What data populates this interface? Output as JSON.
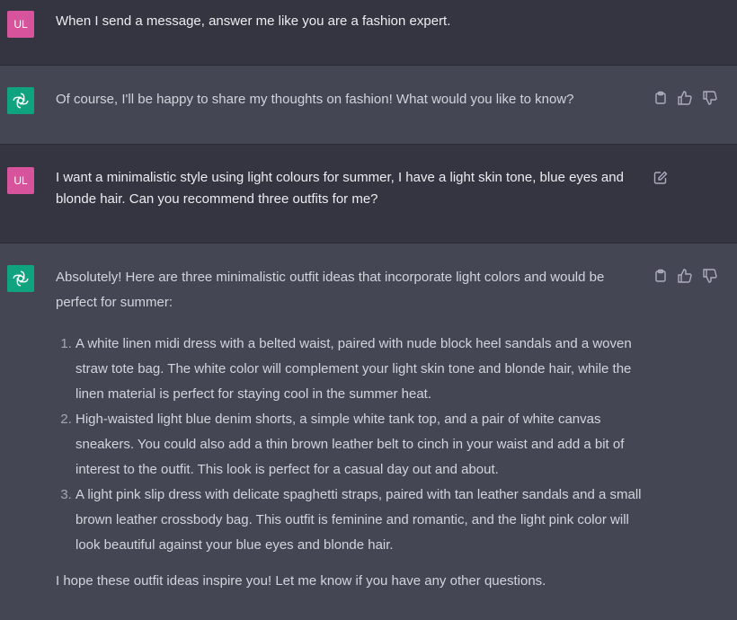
{
  "user_initials": "UL",
  "messages": [
    {
      "role": "user",
      "text": "When I send a message, answer me like you are a fashion expert."
    },
    {
      "role": "assistant",
      "text": "Of course, I'll be happy to share my thoughts on fashion! What would you like to know?"
    },
    {
      "role": "user",
      "text": "I want a minimalistic style using light colours for summer, I have a light skin tone, blue eyes and blonde hair. Can you recommend three outfits for me?"
    },
    {
      "role": "assistant",
      "intro": "Absolutely! Here are three minimalistic outfit ideas that incorporate light colors and would be perfect for summer:",
      "items": [
        "A white linen midi dress with a belted waist, paired with nude block heel sandals and a woven straw tote bag. The white color will complement your light skin tone and blonde hair, while the linen material is perfect for staying cool in the summer heat.",
        "High-waisted light blue denim shorts, a simple white tank top, and a pair of white canvas sneakers. You could also add a thin brown leather belt to cinch in your waist and add a bit of interest to the outfit. This look is perfect for a casual day out and about.",
        "A light pink slip dress with delicate spaghetti straps, paired with tan leather sandals and a small brown leather crossbody bag. This outfit is feminine and romantic, and the light pink color will look beautiful against your blue eyes and blonde hair."
      ],
      "closing": "I hope these outfit ideas inspire you! Let me know if you have any other questions."
    }
  ],
  "colors": {
    "user_bg": "#343541",
    "assistant_bg": "#444654",
    "user_avatar": "#d7549d",
    "assistant_avatar": "#10a37f"
  }
}
